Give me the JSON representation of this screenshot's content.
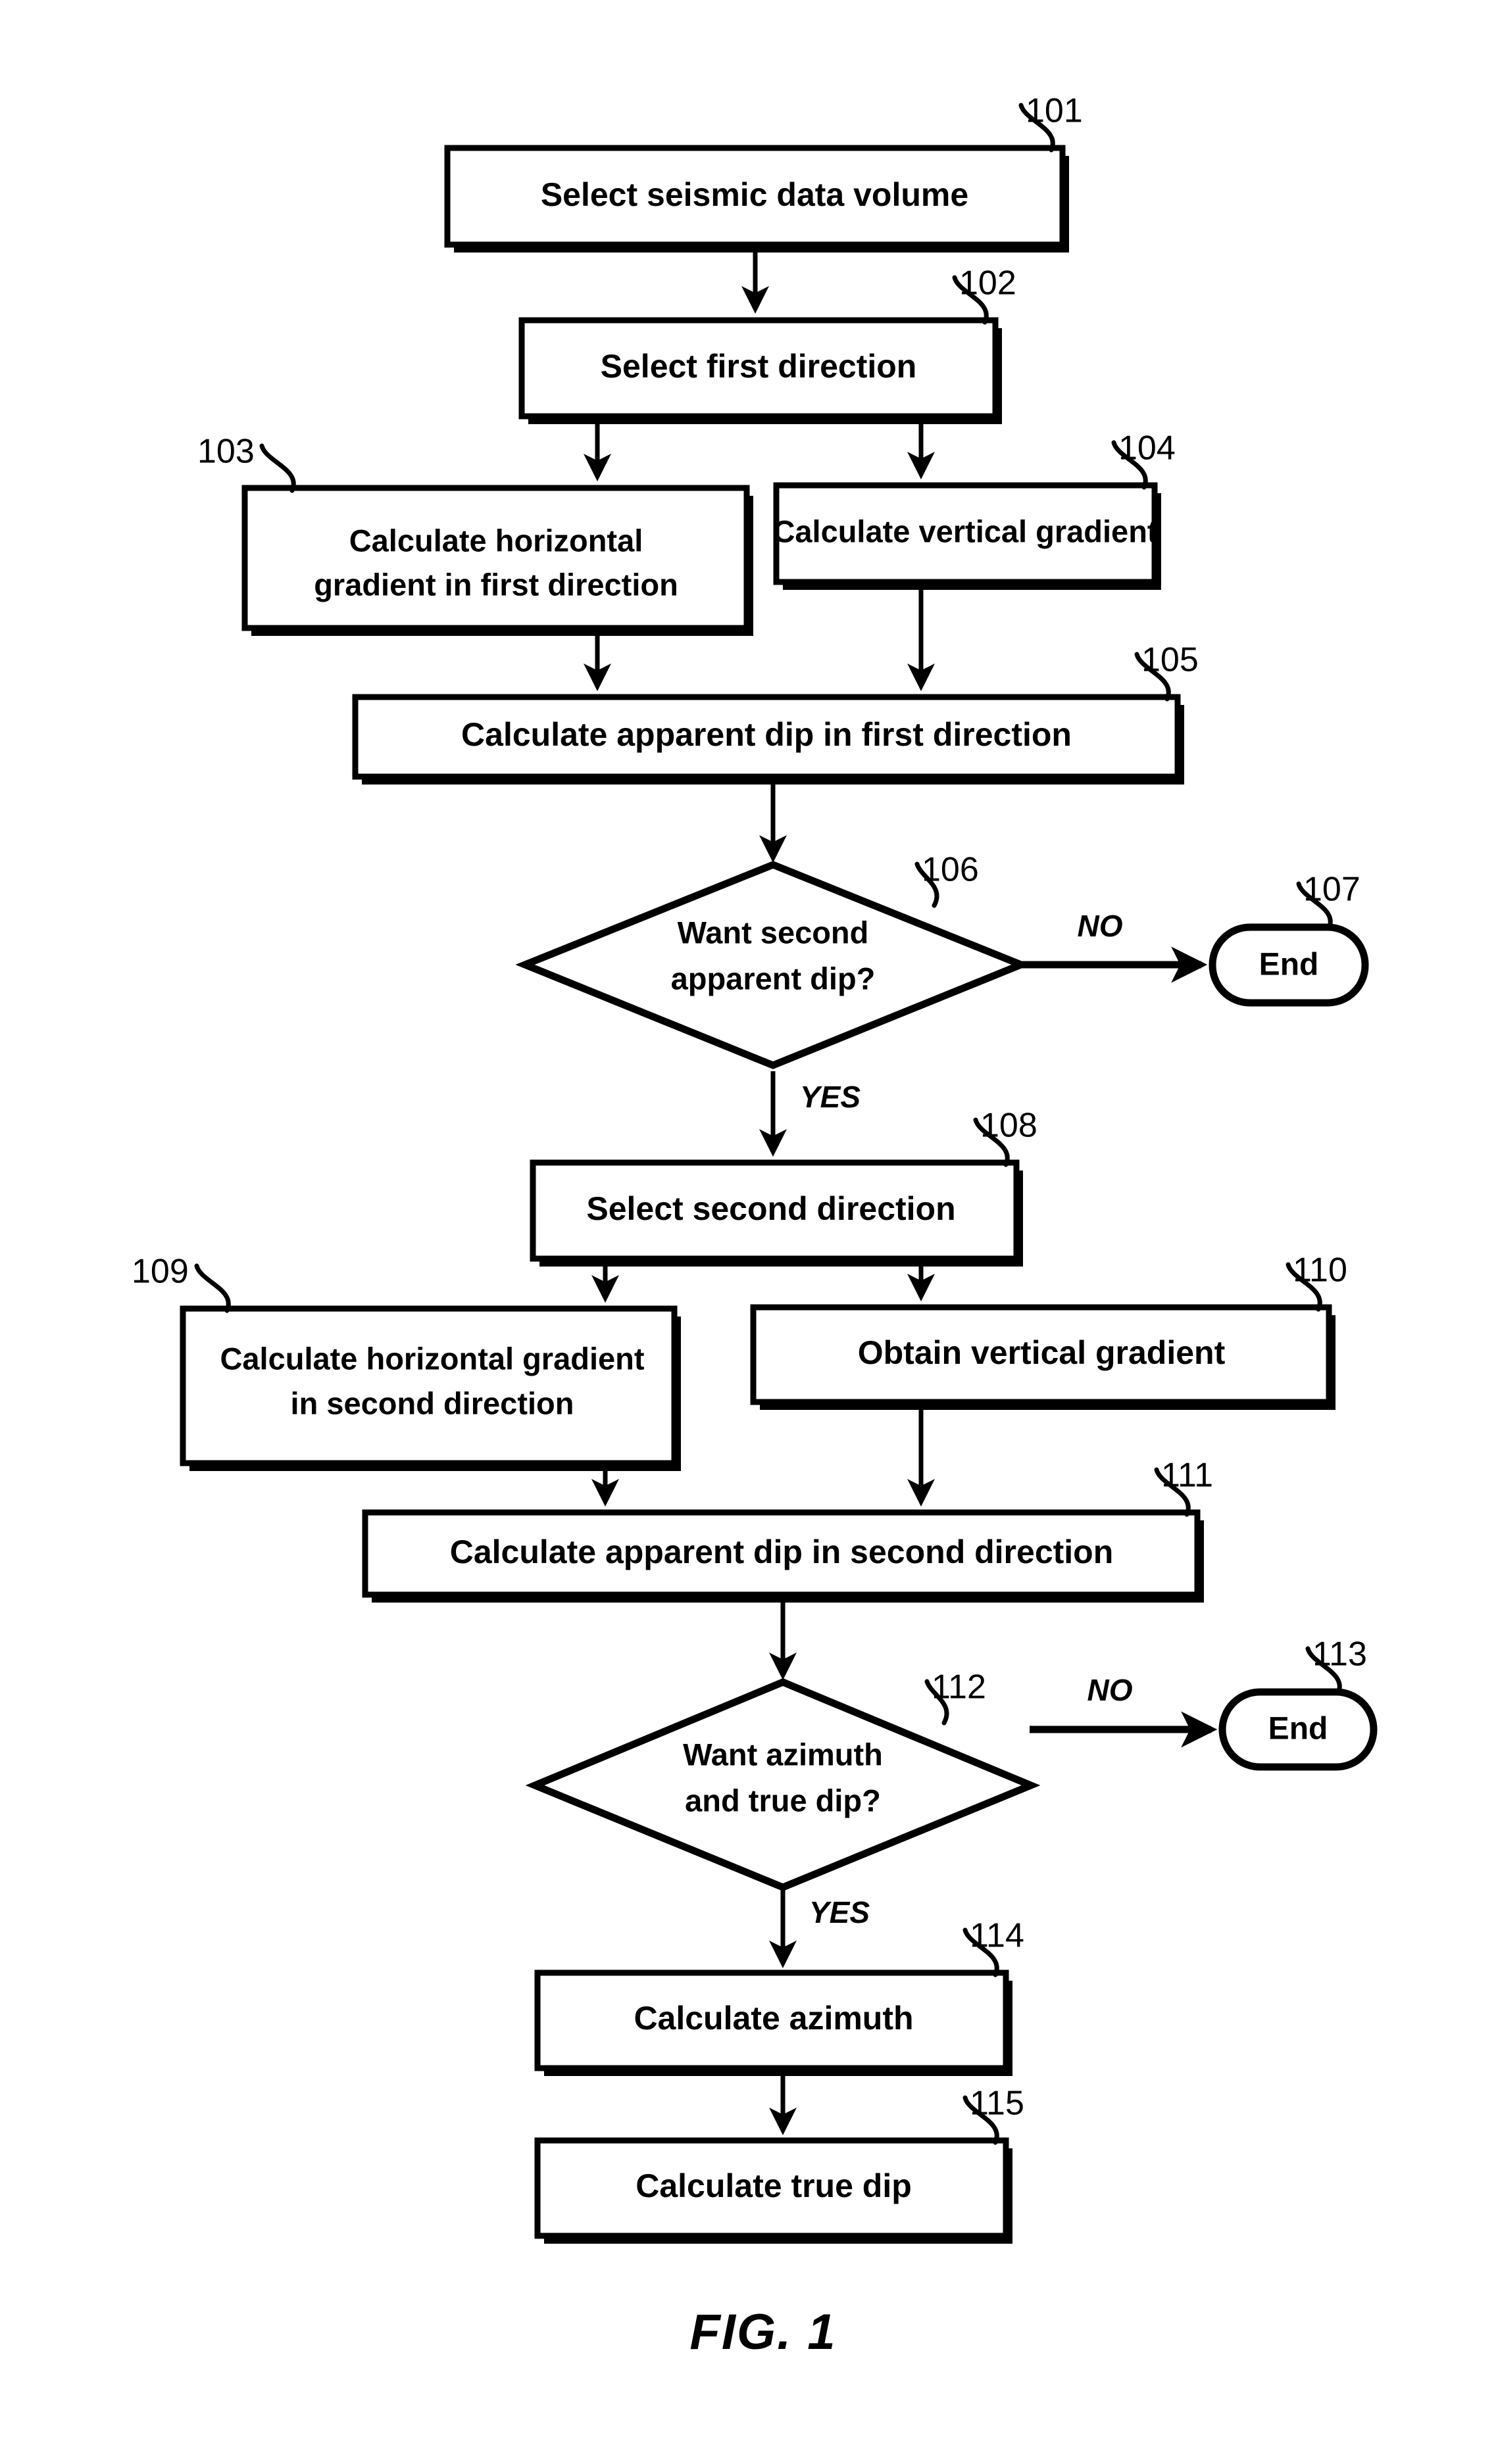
{
  "figure": {
    "caption": "FIG. 1",
    "branch_yes": "YES",
    "branch_no": "NO"
  },
  "chart_data": {
    "type": "flowchart",
    "title": "FIG. 1",
    "orientation": "top-to-bottom",
    "nodes": [
      {
        "ref": "101",
        "shape": "process",
        "label": "Select seismic data volume"
      },
      {
        "ref": "102",
        "shape": "process",
        "label": "Select first direction"
      },
      {
        "ref": "103",
        "shape": "process",
        "label_line1": "Calculate horizontal",
        "label_line2": "gradient in first direction"
      },
      {
        "ref": "104",
        "shape": "process",
        "label": "Calculate vertical gradient"
      },
      {
        "ref": "105",
        "shape": "process",
        "label": "Calculate apparent dip in first direction"
      },
      {
        "ref": "106",
        "shape": "decision",
        "label_line1": "Want second",
        "label_line2": "apparent dip?"
      },
      {
        "ref": "107",
        "shape": "terminator",
        "label": "End"
      },
      {
        "ref": "108",
        "shape": "process",
        "label": "Select second direction"
      },
      {
        "ref": "109",
        "shape": "process",
        "label_line1": "Calculate horizontal gradient",
        "label_line2": "in second direction"
      },
      {
        "ref": "110",
        "shape": "process",
        "label": "Obtain vertical gradient"
      },
      {
        "ref": "111",
        "shape": "process",
        "label": "Calculate apparent dip in second direction"
      },
      {
        "ref": "112",
        "shape": "decision",
        "label_line1": "Want azimuth",
        "label_line2": "and true dip?"
      },
      {
        "ref": "113",
        "shape": "terminator",
        "label": "End"
      },
      {
        "ref": "114",
        "shape": "process",
        "label": "Calculate azimuth"
      },
      {
        "ref": "115",
        "shape": "process",
        "label": "Calculate true dip"
      }
    ],
    "edges": [
      {
        "from": "101",
        "to": "102",
        "label": ""
      },
      {
        "from": "102",
        "to": "103",
        "label": ""
      },
      {
        "from": "102",
        "to": "104",
        "label": ""
      },
      {
        "from": "103",
        "to": "105",
        "label": ""
      },
      {
        "from": "104",
        "to": "105",
        "label": ""
      },
      {
        "from": "105",
        "to": "106",
        "label": ""
      },
      {
        "from": "106",
        "to": "107",
        "label": "NO"
      },
      {
        "from": "106",
        "to": "108",
        "label": "YES"
      },
      {
        "from": "108",
        "to": "109",
        "label": ""
      },
      {
        "from": "108",
        "to": "110",
        "label": ""
      },
      {
        "from": "109",
        "to": "111",
        "label": ""
      },
      {
        "from": "110",
        "to": "111",
        "label": ""
      },
      {
        "from": "111",
        "to": "112",
        "label": ""
      },
      {
        "from": "112",
        "to": "113",
        "label": "NO"
      },
      {
        "from": "112",
        "to": "114",
        "label": "YES"
      },
      {
        "from": "114",
        "to": "115",
        "label": ""
      }
    ]
  },
  "nodes": {
    "n101": {
      "ref": "101",
      "label": "Select seismic data volume"
    },
    "n102": {
      "ref": "102",
      "label": "Select first direction"
    },
    "n103": {
      "ref": "103",
      "line1": "Calculate horizontal",
      "line2": "gradient in first direction"
    },
    "n104": {
      "ref": "104",
      "label": "Calculate vertical gradient"
    },
    "n105": {
      "ref": "105",
      "label": "Calculate apparent dip in first direction"
    },
    "n106": {
      "ref": "106",
      "line1": "Want second",
      "line2": "apparent dip?"
    },
    "n107": {
      "ref": "107",
      "label": "End"
    },
    "n108": {
      "ref": "108",
      "label": "Select second direction"
    },
    "n109": {
      "ref": "109",
      "line1": "Calculate horizontal gradient",
      "line2": "in second direction"
    },
    "n110": {
      "ref": "110",
      "label": "Obtain vertical gradient"
    },
    "n111": {
      "ref": "111",
      "label": "Calculate apparent dip in second direction"
    },
    "n112": {
      "ref": "112",
      "line1": "Want azimuth",
      "line2": "and true dip?"
    },
    "n113": {
      "ref": "113",
      "label": "End"
    },
    "n114": {
      "ref": "114",
      "label": "Calculate azimuth"
    },
    "n115": {
      "ref": "115",
      "label": "Calculate true dip"
    }
  },
  "labels": {
    "no_1": "NO",
    "yes_1": "YES",
    "no_2": "NO",
    "yes_2": "YES"
  },
  "colors": {
    "ink": "#000000",
    "paper": "#ffffff"
  }
}
